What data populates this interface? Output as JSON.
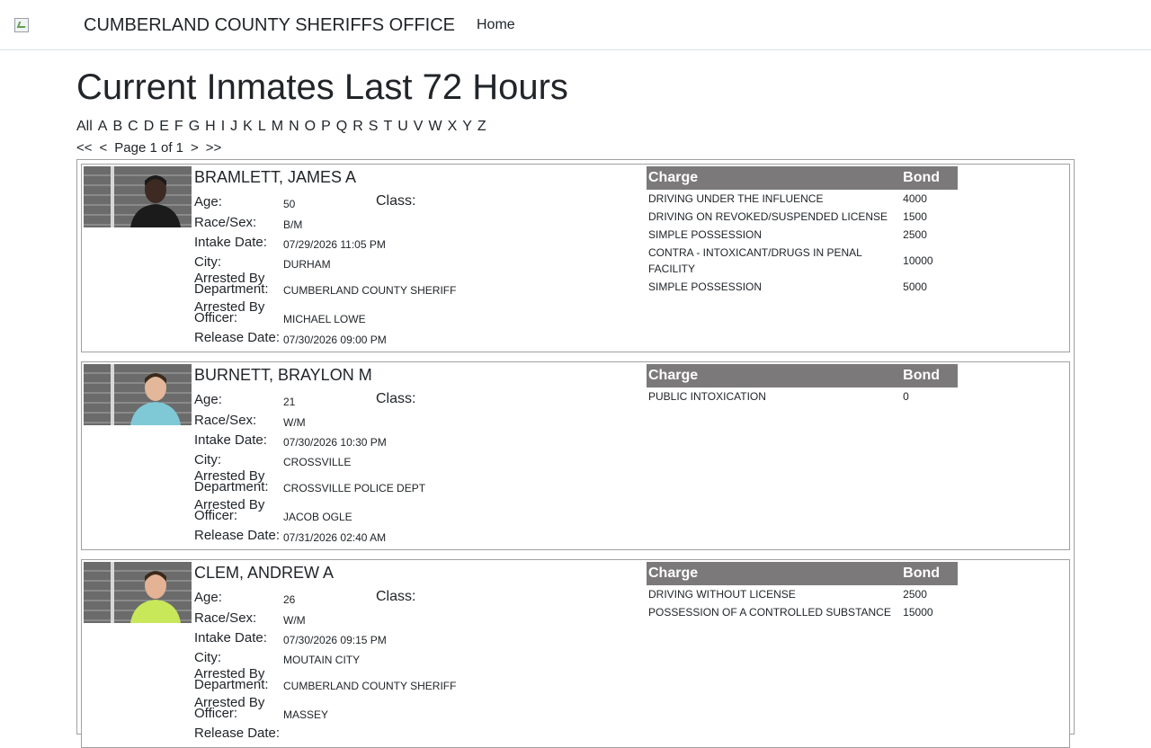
{
  "header": {
    "brand_title": "CUMBERLAND COUNTY SHERIFFS OFFICE",
    "nav_home": "Home"
  },
  "page": {
    "title": "Current Inmates Last 72 Hours"
  },
  "alphabet": [
    "All",
    "A",
    "B",
    "C",
    "D",
    "E",
    "F",
    "G",
    "H",
    "I",
    "J",
    "K",
    "L",
    "M",
    "N",
    "O",
    "P",
    "Q",
    "R",
    "S",
    "T",
    "U",
    "V",
    "W",
    "X",
    "Y",
    "Z"
  ],
  "pager": {
    "first": "<<",
    "prev": "<",
    "status": "Page 1 of 1",
    "next": ">",
    "last": ">>"
  },
  "labels": {
    "age": "Age:",
    "class": "Class:",
    "race_sex": "Race/Sex:",
    "intake_date": "Intake Date:",
    "city": "City:",
    "arrested_by_department": "Arrested By Department:",
    "arrested_by_officer": "Arrested By Officer:",
    "release_date": "Release Date:",
    "charge": "Charge",
    "bond": "Bond"
  },
  "inmates": [
    {
      "name": "BRAMLETT, JAMES A",
      "age": "50",
      "class": "",
      "race_sex": "B/M",
      "intake_date": "07/29/2026 11:05 PM",
      "city": "DURHAM",
      "department": "CUMBERLAND COUNTY SHERIFF",
      "officer": "MICHAEL LOWE",
      "release_date": "07/30/2026 09:00 PM",
      "charges": [
        {
          "charge": "DRIVING UNDER THE INFLUENCE",
          "bond": "4000"
        },
        {
          "charge": "DRIVING ON REVOKED/SUSPENDED LICENSE",
          "bond": "1500"
        },
        {
          "charge": "SIMPLE POSSESSION",
          "bond": "2500"
        },
        {
          "charge": "CONTRA - INTOXICANT/DRUGS IN PENAL FACILITY",
          "bond": "10000"
        },
        {
          "charge": "SIMPLE POSSESSION",
          "bond": "5000"
        }
      ]
    },
    {
      "name": "BURNETT, BRAYLON M",
      "age": "21",
      "class": "",
      "race_sex": "W/M",
      "intake_date": "07/30/2026 10:30 PM",
      "city": "CROSSVILLE",
      "department": "CROSSVILLE POLICE DEPT",
      "officer": "JACOB OGLE",
      "release_date": "07/31/2026 02:40 AM",
      "charges": [
        {
          "charge": "PUBLIC INTOXICATION",
          "bond": "0"
        }
      ]
    },
    {
      "name": "CLEM, ANDREW A",
      "age": "26",
      "class": "",
      "race_sex": "W/M",
      "intake_date": "07/30/2026 09:15 PM",
      "city": "MOUTAIN CITY",
      "department": "CUMBERLAND COUNTY SHERIFF",
      "officer": "MASSEY",
      "release_date": "",
      "charges": [
        {
          "charge": "DRIVING WITHOUT LICENSE",
          "bond": "2500"
        },
        {
          "charge": "POSSESSION OF A CONTROLLED SUBSTANCE",
          "bond": "15000"
        }
      ]
    }
  ],
  "colors": {
    "table_header_bg": "#7b7979",
    "border": "#a0a0a0"
  }
}
